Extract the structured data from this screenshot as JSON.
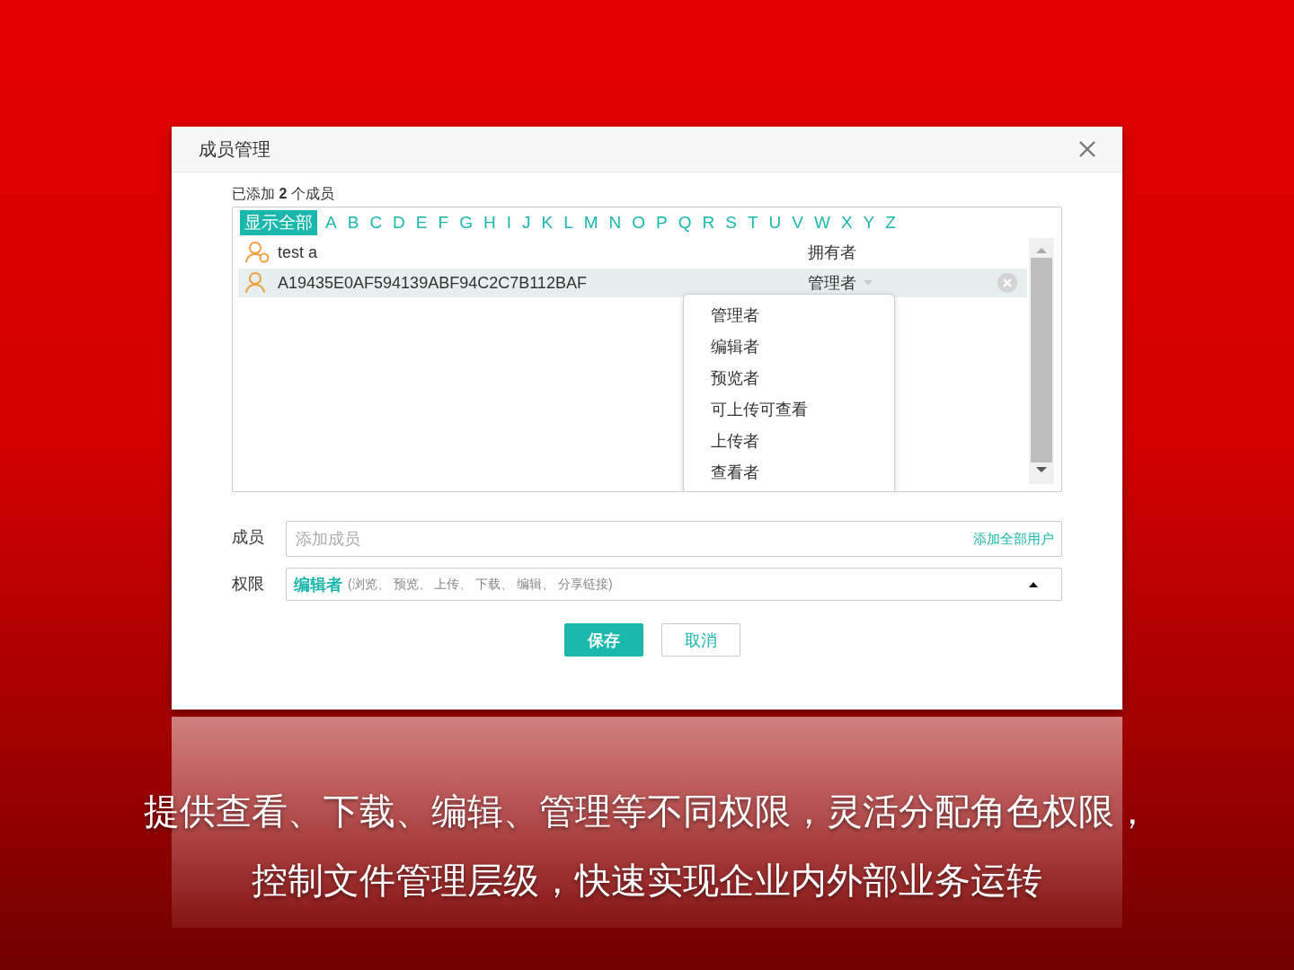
{
  "dialog": {
    "title": "成员管理",
    "added": "已添加 **2** 个成员",
    "letters": [
      {
        "label": "显示全部",
        "selected": true
      },
      {
        "label": "A",
        "selected": false
      },
      {
        "label": "B",
        "selected": false
      },
      {
        "label": "C",
        "selected": false
      },
      {
        "label": "D",
        "selected": false
      },
      {
        "label": "E",
        "selected": false
      },
      {
        "label": "F",
        "selected": false
      },
      {
        "label": "G",
        "selected": false
      },
      {
        "label": "H",
        "selected": false
      },
      {
        "label": "I",
        "selected": false
      },
      {
        "label": "J",
        "selected": false
      },
      {
        "label": "K",
        "selected": false
      },
      {
        "label": "L",
        "selected": false
      },
      {
        "label": "M",
        "selected": false
      },
      {
        "label": "N",
        "selected": false
      },
      {
        "label": "O",
        "selected": false
      },
      {
        "label": "P",
        "selected": false
      },
      {
        "label": "Q",
        "selected": false
      },
      {
        "label": "R",
        "selected": false
      },
      {
        "label": "S",
        "selected": false
      },
      {
        "label": "T",
        "selected": false
      },
      {
        "label": "U",
        "selected": false
      },
      {
        "label": "V",
        "selected": false
      },
      {
        "label": "W",
        "selected": false
      },
      {
        "label": "X",
        "selected": false
      },
      {
        "label": "Y",
        "selected": false
      },
      {
        "label": "Z",
        "selected": false
      }
    ],
    "members": [
      {
        "kind": "owner",
        "name": "test a",
        "role": "拥有者",
        "selected": false
      },
      {
        "kind": "member",
        "name": "A19435E0AF594139ABF94C2C7B112BAF",
        "role": "管理者",
        "selected": true
      }
    ],
    "role_menu": [
      "管理者",
      "编辑者",
      "预览者",
      "可上传可查看",
      "上传者",
      "查看者"
    ],
    "member_field": {
      "label": "成员",
      "placeholder": "添加成员",
      "link": "添加全部用户"
    },
    "permission_field": {
      "label": "权限",
      "role": "编辑者",
      "detail": "(浏览、 预览、 上传、 下载、 编辑、 分享链接)",
      "expanded": true
    },
    "buttons": [
      {
        "kind": "primary",
        "label": "保存"
      },
      {
        "kind": "secondary",
        "label": "取消"
      }
    ]
  },
  "caption": [
    "提供查看、下载、编辑、管理等不同权限，灵活分配角色权限，",
    "控制文件管理层级，快速实现企业内外部业务运转"
  ]
}
